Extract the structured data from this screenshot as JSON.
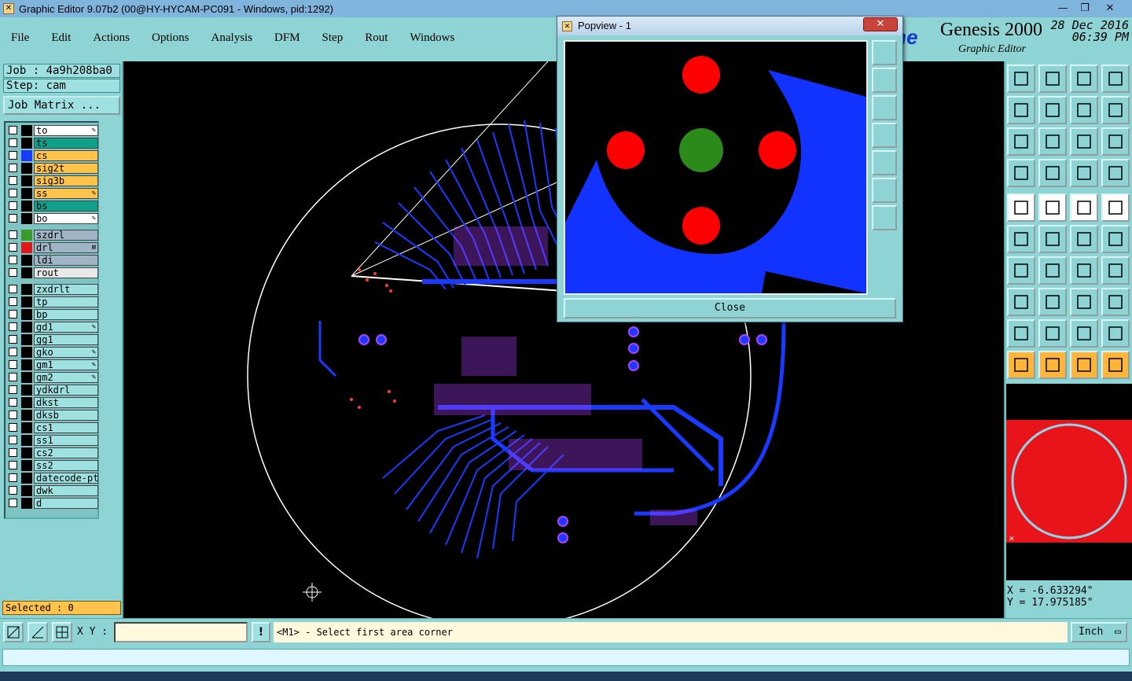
{
  "window": {
    "title": "Graphic Editor 9.07b2 (00@HY-HYCAM-PC091 - Windows, pid:1292)",
    "minimize_icon": "minimize-icon",
    "maximize_icon": "maximize-icon",
    "close_icon": "close-icon"
  },
  "menu": {
    "items": [
      "File",
      "Edit",
      "Actions",
      "Options",
      "Analysis",
      "DFM",
      "Step",
      "Rout",
      "Windows"
    ]
  },
  "brand": {
    "logo_text": "ine",
    "name": "Genesis 2000",
    "subtitle": "Graphic Editor",
    "date": "28 Dec 2016",
    "time": "06:39 PM"
  },
  "job": {
    "job_label": "Job : 4a9h208ba0",
    "step_label": "Step: cam",
    "matrix_button": "Job Matrix ..."
  },
  "layers": [
    {
      "name": "to",
      "color": "#ffffff",
      "swatch": "#000000",
      "mark": "edit"
    },
    {
      "name": "ts",
      "color": "#12a08a",
      "swatch": "#000000",
      "mark": ""
    },
    {
      "name": "cs",
      "color": "#ffc24a",
      "swatch": "#1a3aff",
      "mark": ""
    },
    {
      "name": "sig2t",
      "color": "#ffc24a",
      "swatch": "#000000",
      "mark": ""
    },
    {
      "name": "sig3b",
      "color": "#ffc24a",
      "swatch": "#000000",
      "mark": ""
    },
    {
      "name": "ss",
      "color": "#ffc24a",
      "swatch": "#000000",
      "mark": "edit"
    },
    {
      "name": "bs",
      "color": "#12a08a",
      "swatch": "#000000",
      "mark": ""
    },
    {
      "name": "bo",
      "color": "#ffffff",
      "swatch": "#000000",
      "mark": "edit"
    },
    {
      "name": "szdrl",
      "color": "#9fb4c4",
      "swatch": "#3a9a2a",
      "mark": ""
    },
    {
      "name": "drl",
      "color": "#9fb4c4",
      "swatch": "#e01818",
      "mark": "grid"
    },
    {
      "name": "ldi",
      "color": "#9fb4c4",
      "swatch": "#000000",
      "mark": ""
    },
    {
      "name": "rout",
      "color": "#e8e8e8",
      "swatch": "#000000",
      "mark": ""
    },
    {
      "name": "zxdrlt",
      "color": "#9fe0e0",
      "swatch": "#000000",
      "mark": ""
    },
    {
      "name": "tp",
      "color": "#9fe0e0",
      "swatch": "#000000",
      "mark": ""
    },
    {
      "name": "bp",
      "color": "#9fe0e0",
      "swatch": "#000000",
      "mark": ""
    },
    {
      "name": "gd1",
      "color": "#9fe0e0",
      "swatch": "#000000",
      "mark": "edit"
    },
    {
      "name": "gg1",
      "color": "#9fe0e0",
      "swatch": "#000000",
      "mark": ""
    },
    {
      "name": "gko",
      "color": "#9fe0e0",
      "swatch": "#000000",
      "mark": "edit"
    },
    {
      "name": "gm1",
      "color": "#9fe0e0",
      "swatch": "#000000",
      "mark": "edit"
    },
    {
      "name": "gm2",
      "color": "#9fe0e0",
      "swatch": "#000000",
      "mark": "edit"
    },
    {
      "name": "ydkdrl",
      "color": "#9fe0e0",
      "swatch": "#000000",
      "mark": ""
    },
    {
      "name": "dkst",
      "color": "#9fe0e0",
      "swatch": "#000000",
      "mark": ""
    },
    {
      "name": "dksb",
      "color": "#9fe0e0",
      "swatch": "#000000",
      "mark": ""
    },
    {
      "name": "cs1",
      "color": "#9fe0e0",
      "swatch": "#000000",
      "mark": ""
    },
    {
      "name": "ss1",
      "color": "#9fe0e0",
      "swatch": "#000000",
      "mark": ""
    },
    {
      "name": "cs2",
      "color": "#9fe0e0",
      "swatch": "#000000",
      "mark": ""
    },
    {
      "name": "ss2",
      "color": "#9fe0e0",
      "swatch": "#000000",
      "mark": ""
    },
    {
      "name": "datecode-ptc",
      "color": "#9fe0e0",
      "swatch": "#000000",
      "mark": ""
    },
    {
      "name": "dwk",
      "color": "#9fe0e0",
      "swatch": "#000000",
      "mark": ""
    },
    {
      "name": "d",
      "color": "#9fe0e0",
      "swatch": "#000000",
      "mark": ""
    }
  ],
  "selection": {
    "label": "Selected : 0"
  },
  "popview": {
    "title": "Popview - 1",
    "close_button": "Close",
    "close_x": "✕"
  },
  "coords": {
    "x": "X = -6.633294\"",
    "y": "Y = 17.975185\""
  },
  "command": {
    "xy_label": "X Y :",
    "xy_value": "",
    "excl": "!",
    "prompt": "<M1> - Select first area corner",
    "units": "Inch"
  },
  "colors": {
    "panel": "#8fd4d4",
    "copper": "#1a3aff",
    "drill": "#ff0000",
    "pad": "#2a8a1a"
  }
}
